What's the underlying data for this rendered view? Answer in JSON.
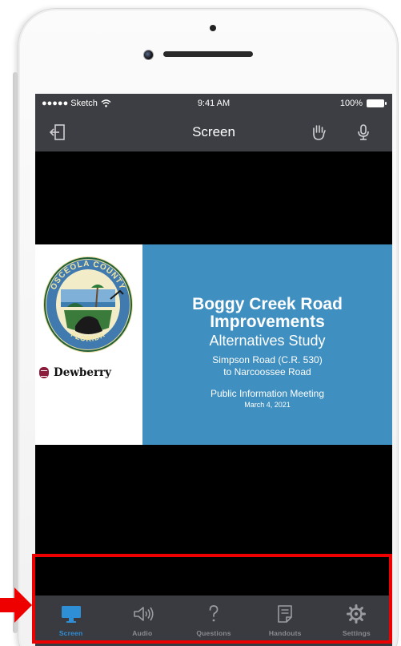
{
  "status_bar": {
    "carrier": "●●●●● Sketch",
    "time": "9:41 AM",
    "battery": "100%"
  },
  "nav": {
    "title": "Screen",
    "left_icon": "exit-icon",
    "right_icons": [
      "raise-hand-icon",
      "microphone-icon"
    ]
  },
  "slide": {
    "title_line1": "Boggy Creek Road",
    "title_line2": "Improvements",
    "subtitle": "Alternatives Study",
    "road_line1": "Simpson Road (C.R. 530)",
    "road_line2": "to Narcoossee Road",
    "meeting": "Public Information Meeting",
    "date": "March 4, 2021",
    "seal_top_text": "OSCEOLA COUNTY",
    "seal_bottom_text": "FLORIDA",
    "dewberry": "Dewberry",
    "colors": {
      "panel": "#3f8fc0",
      "seal_ring": "#1f5f3a",
      "seal_gold": "#d4b23a"
    }
  },
  "tabs": [
    {
      "label": "Screen",
      "icon": "monitor-icon",
      "active": true
    },
    {
      "label": "Audio",
      "icon": "speaker-icon",
      "active": false
    },
    {
      "label": "Questions",
      "icon": "question-icon",
      "active": false
    },
    {
      "label": "Handouts",
      "icon": "handout-icon",
      "active": false
    },
    {
      "label": "Settings",
      "icon": "gear-icon",
      "active": false
    }
  ],
  "accent": {
    "highlight": "#ef0000",
    "active_tab": "#2f8fd6"
  }
}
